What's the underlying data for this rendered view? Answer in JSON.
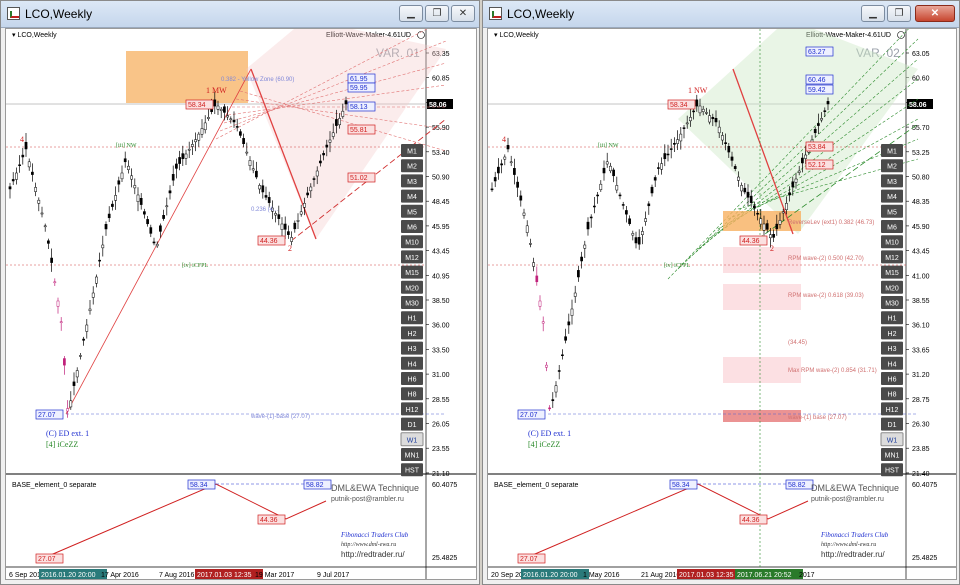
{
  "windows": [
    {
      "title": "LCO,Weekly",
      "symbol_label": "LCO,Weekly",
      "indicator_name": "Elliott-Wave-Maker-4.61UD",
      "variant": "VAR. 01",
      "current_price": "58.06",
      "price_scale": [
        "63.35",
        "60.85",
        "58.40",
        "55.90",
        "53.40",
        "50.90",
        "48.45",
        "45.95",
        "43.45",
        "40.95",
        "38.50",
        "36.00",
        "33.50",
        "31.00",
        "28.55",
        "26.05",
        "23.55",
        "21.10"
      ],
      "date_axis": [
        "6 Sep 2015",
        "2016.01.20 20:00",
        "17 Apr 2016",
        "7 Aug 2016",
        "2017.01.03 12:35",
        "19 Mar 2017",
        "9 Jul 2017"
      ],
      "subwindow": {
        "title": "BASE_element_0 separate",
        "scale_top": "60.4075",
        "scale_bottom": "25.4825"
      },
      "annotations": {
        "wave1": "1 MW",
        "wave2": "2",
        "label_4": "4",
        "box_5834": "58.34",
        "box_4436": "44.36",
        "box_2707": "27.07",
        "lvl_6195": "61.95",
        "lvl_5995": "59.95",
        "lvl_5813": "58.13",
        "lvl_5581": "55.81",
        "lvl_5102": "51.02",
        "wave_c_ed": "(C) ED ext. 1",
        "wave_4_iceZZ": "[4] iCeZZ",
        "wave_iii_nw": "[iii] NW",
        "wave_iv_icfpl": "[iv] iCFPL",
        "yellow_zone": "0.382 - Yellow Zone (60.90)",
        "fib_0236": "0.236 (4...",
        "wave_base_label": "wave-(1)-base (27.07)",
        "sub_5834": "58.34",
        "sub_5882": "58.82",
        "sub_4436": "44.36",
        "sub_2707": "27.07"
      }
    },
    {
      "title": "LCO,Weekly",
      "symbol_label": "LCO,Weekly",
      "indicator_name": "Elliott-Wave-Maker-4.61UD",
      "variant": "VAR. 02",
      "current_price": "58.06",
      "price_scale": [
        "63.05",
        "60.60",
        "58.15",
        "55.70",
        "53.25",
        "50.80",
        "48.35",
        "45.90",
        "43.45",
        "41.00",
        "38.55",
        "36.10",
        "33.65",
        "31.20",
        "28.75",
        "26.30",
        "23.85",
        "21.40"
      ],
      "date_axis": [
        "20 Sep 2015",
        "2016.01.20 20:00",
        "1 May 2016",
        "21 Aug 2016",
        "2017.01.03 12:35",
        "2017.06.21 20:52",
        "2017"
      ],
      "subwindow": {
        "title": "BASE_element_0 separate",
        "scale_top": "60.4075",
        "scale_bottom": "25.4825"
      },
      "annotations": {
        "wave1": "1 NW",
        "wave2": "2",
        "label_4": "4",
        "box_5834": "58.34",
        "box_4436": "44.36",
        "box_2707": "27.07",
        "lvl_6327": "63.27",
        "lvl_6046": "60.46",
        "lvl_5942": "59.42",
        "lvl_5384": "53.84",
        "lvl_5212": "52.12",
        "wave_c_ed": "(C) ED ext. 1",
        "wave_4_iceZZ": "[4] iCeZZ",
        "wave_iii_nw": "[iii] NW",
        "wave_iv_icfpl": "[iv] iCFPL",
        "reverse_lev": "ReverseLev (ext1) 0.382 (46.73)",
        "rpm_500": "RPM wave-(2) 0.500 (42.70)",
        "rpm_618": "RPM wave-(2) 0.618 (39.03)",
        "lvl_3445": "(34.45)",
        "max_rpm": "Max RPM wave-(2) 0.854 (31.71)",
        "wave_base_label": "wave-(1) base (27.07)",
        "sub_5834": "58.34",
        "sub_5882": "58.82",
        "sub_4436": "44.36",
        "sub_2707": "27.07"
      }
    }
  ],
  "timeframes": [
    "M1",
    "M2",
    "M3",
    "M4",
    "M5",
    "M6",
    "M10",
    "M12",
    "M15",
    "M20",
    "M30",
    "H1",
    "H2",
    "H3",
    "H4",
    "H6",
    "H8",
    "H12",
    "D1",
    "W1",
    "MN1",
    "HST"
  ],
  "selected_timeframe": "W1",
  "watermark": {
    "line1": "DML&EWA Technique",
    "line2": "putnik-post@rambler.ru",
    "line3": "Fibonacci Traders Club",
    "line4": "http://www.dml-ewa.ru",
    "line5": "http://redtrader.ru/"
  },
  "colors": {
    "accent_red": "#d02020",
    "accent_blue": "#2030d0",
    "fib_green": "#2a8a2a",
    "zone_orange": "#f7b060"
  }
}
